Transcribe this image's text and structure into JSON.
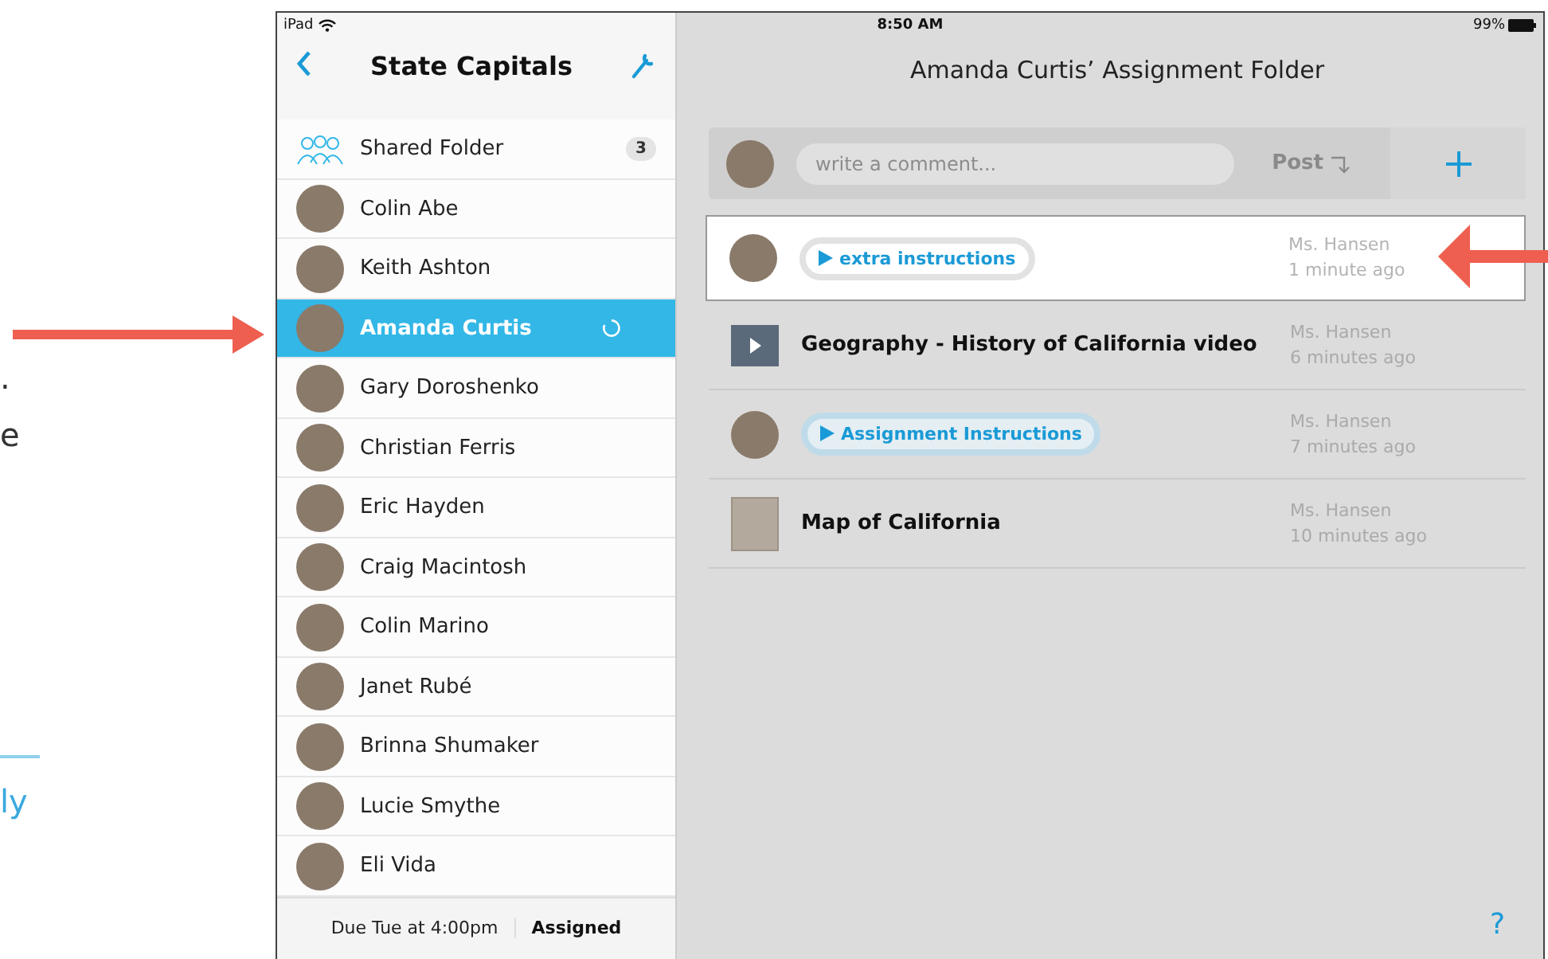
{
  "margin_texts": [
    {
      "kind": "plain",
      "text": "."
    },
    {
      "kind": "plain",
      "text": "e"
    },
    {
      "kind": "link",
      "text": "ly"
    }
  ],
  "status_bar": {
    "device": "iPad",
    "time": "8:50 AM",
    "battery": "99%"
  },
  "sidebar": {
    "title": "State Capitals",
    "items": [
      {
        "kind": "folder",
        "name": "Shared Folder",
        "badge": "3",
        "selected": false
      },
      {
        "kind": "student",
        "name": "Colin Abe",
        "selected": false
      },
      {
        "kind": "student",
        "name": "Keith Ashton",
        "selected": false
      },
      {
        "kind": "student",
        "name": "Amanda Curtis",
        "selected": true
      },
      {
        "kind": "student",
        "name": "Gary Doroshenko",
        "selected": false
      },
      {
        "kind": "student",
        "name": "Christian Ferris",
        "selected": false
      },
      {
        "kind": "student",
        "name": "Eric Hayden",
        "selected": false
      },
      {
        "kind": "student",
        "name": "Craig Macintosh",
        "selected": false
      },
      {
        "kind": "student",
        "name": "Colin Marino",
        "selected": false
      },
      {
        "kind": "student",
        "name": "Janet Rubé",
        "selected": false
      },
      {
        "kind": "student",
        "name": "Brinna Shumaker",
        "selected": false
      },
      {
        "kind": "student",
        "name": "Lucie Smythe",
        "selected": false
      },
      {
        "kind": "student",
        "name": "Eli Vida",
        "selected": false
      }
    ],
    "footer": {
      "due": "Due Tue at 4:00pm",
      "status": "Assigned"
    }
  },
  "folder": {
    "title": "Amanda Curtis’ Assignment Folder",
    "comment": {
      "placeholder": "write a comment...",
      "post": "Post"
    },
    "items": [
      {
        "kind": "audio",
        "label": "extra instructions",
        "author": "Ms. Hansen",
        "time": "1 minute ago",
        "highlighted": true
      },
      {
        "kind": "video",
        "label": "Geography - History of California video",
        "author": "Ms. Hansen",
        "time": "6 minutes ago",
        "highlighted": false
      },
      {
        "kind": "audio",
        "label": "Assignment Instructions",
        "author": "Ms. Hansen",
        "time": "7 minutes ago",
        "highlighted": false
      },
      {
        "kind": "image",
        "label": "Map of California",
        "author": "Ms. Hansen",
        "time": "10 minutes ago",
        "highlighted": false
      }
    ],
    "help": "?"
  }
}
